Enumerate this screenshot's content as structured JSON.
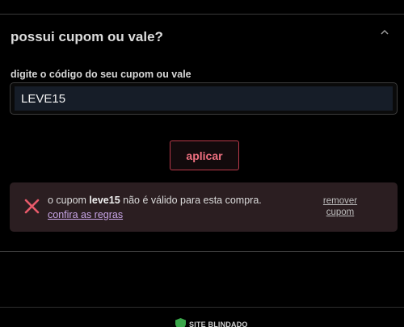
{
  "coupon_section": {
    "title": "possui cupom ou vale?",
    "collapse_icon": "chevron-up-icon",
    "field_label": "digite o código do seu cupom ou vale",
    "input_value": "LEVE15",
    "apply_label": "aplicar"
  },
  "error": {
    "icon": "close-x-icon",
    "prefix": "o cupom ",
    "code": "leve15",
    "suffix": " não é válido para esta compra. ",
    "link_label": "confira as regras",
    "remove_label": "remover cupom"
  },
  "footer": {
    "seal_label": "SITE BLINDADO",
    "seal_icon": "shield-icon"
  },
  "colors": {
    "accent": "#f07080",
    "error_bg": "#2b1e21",
    "link": "#c9a6e8",
    "input_bg": "#161d28"
  }
}
